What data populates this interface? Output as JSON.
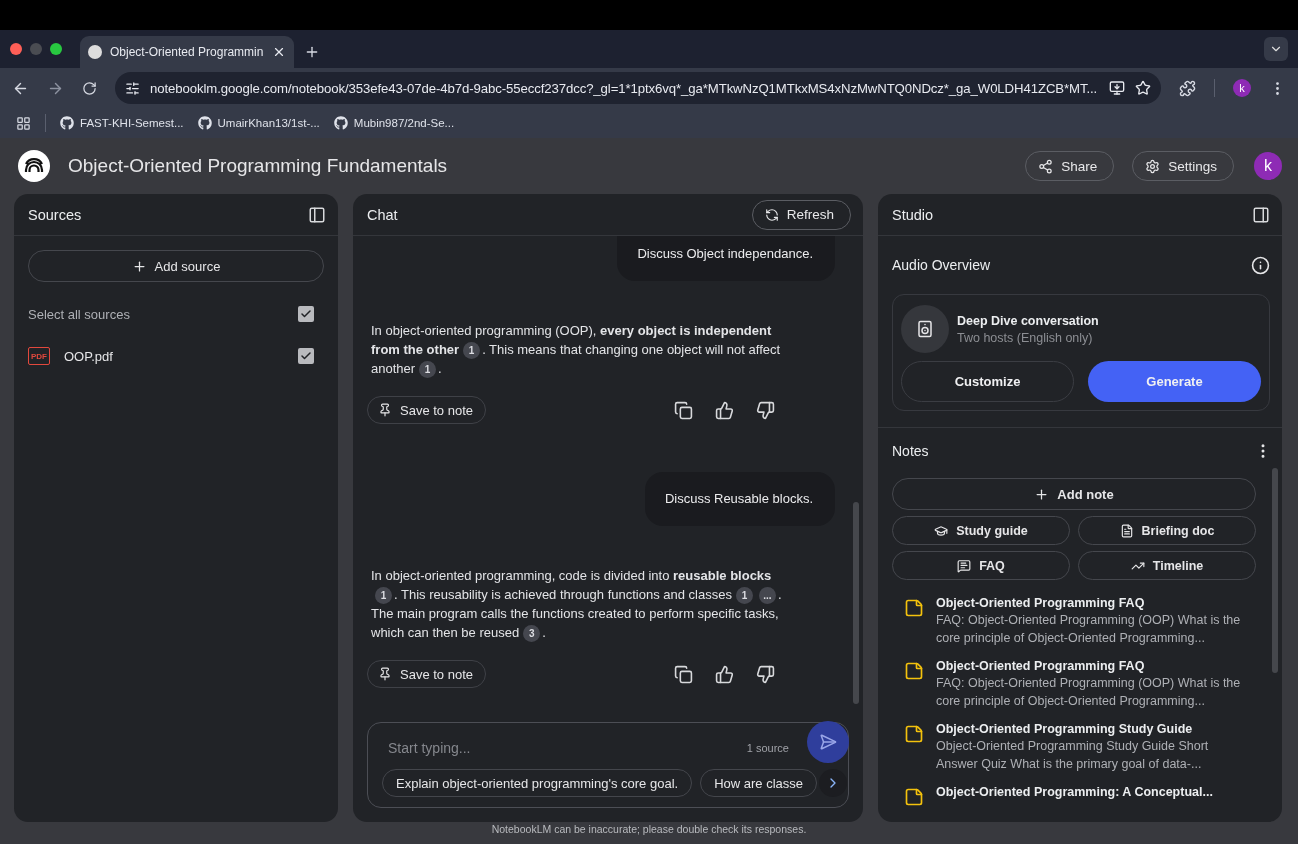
{
  "browser": {
    "tab": {
      "title": "Object-Oriented Programmin",
      "selected": true
    },
    "url": "notebooklm.google.com/notebook/353efe43-07de-4b7d-9abc-55eccf237dcc?_gl=1*1ptx6vq*_ga*MTkwNzQ1MTkxMS4xNzMwNTQ0NDcz*_ga_W0LDH41ZCB*MT...",
    "profile": "k",
    "bookmarks": [
      "FAST-KHI-Semest...",
      "UmairKhan13/1st-...",
      "Mubin987/2nd-Se..."
    ]
  },
  "header": {
    "title": "Object-Oriented Programming Fundamentals",
    "share": "Share",
    "settings": "Settings",
    "avatar": "k"
  },
  "sources": {
    "title": "Sources",
    "add_source": "Add source",
    "select_all": {
      "label": "Select all sources",
      "checked": true
    },
    "items": [
      {
        "badge": "PDF",
        "name": "OOP.pdf",
        "checked": true
      }
    ]
  },
  "chat": {
    "title": "Chat",
    "refresh": "Refresh",
    "messages": [
      {
        "kind": "user",
        "text": "Discuss Object independance."
      },
      {
        "kind": "answer",
        "save": "Save to note",
        "parts": [
          {
            "kind": "text",
            "text": "In object-oriented programming (OOP), **every object is independent from the other**"
          },
          {
            "kind": "cite",
            "text": "1"
          },
          {
            "kind": "text",
            "text": ". This means that changing one object will not affect another"
          },
          {
            "kind": "cite",
            "text": "1"
          },
          {
            "kind": "text",
            "text": "."
          }
        ]
      },
      {
        "kind": "user",
        "text": "Discuss Reusable blocks."
      },
      {
        "kind": "answer",
        "save": "Save to note",
        "parts": [
          {
            "kind": "text",
            "text": "In object-oriented programming, code is divided into **reusable blocks**"
          },
          {
            "kind": "cite",
            "text": "1"
          },
          {
            "kind": "text",
            "text": ". This reusability is achieved through functions and classes"
          },
          {
            "kind": "cite",
            "text": "1"
          },
          {
            "kind": "cite",
            "text": "..."
          },
          {
            "kind": "text",
            "text": ". The main program calls the functions created to perform specific tasks, which can then be reused"
          },
          {
            "kind": "cite",
            "text": "3"
          },
          {
            "kind": "text",
            "text": "."
          }
        ]
      }
    ],
    "input": {
      "placeholder": "Start typing...",
      "source_count": "1 source"
    },
    "suggestions": [
      "Explain object-oriented programming's core goal.",
      "How are classe"
    ]
  },
  "studio": {
    "title": "Studio",
    "audio": {
      "title": "Audio Overview",
      "card_title": "Deep Dive conversation",
      "card_subtitle": "Two hosts (English only)",
      "customize": "Customize",
      "generate": "Generate"
    },
    "notes": {
      "title": "Notes",
      "add_note": "Add note",
      "actions": [
        {
          "kind": "study",
          "label": "Study guide"
        },
        {
          "kind": "briefing",
          "label": "Briefing doc"
        },
        {
          "kind": "faq",
          "label": "FAQ"
        },
        {
          "kind": "timeline",
          "label": "Timeline"
        }
      ],
      "items": [
        {
          "title": "Object-Oriented Programming FAQ",
          "preview": "FAQ: Object-Oriented Programming (OOP) What is the core principle of Object-Oriented Programming..."
        },
        {
          "title": "Object-Oriented Programming FAQ",
          "preview": "FAQ: Object-Oriented Programming (OOP) What is the core principle of Object-Oriented Programming..."
        },
        {
          "title": "Object-Oriented Programming Study Guide",
          "preview": "Object-Oriented Programming Study Guide Short Answer Quiz What is the primary goal of data-..."
        },
        {
          "title": "Object-Oriented Programming: A Conceptual..."
        }
      ]
    }
  },
  "disclaimer": "NotebookLM can be inaccurate; please double check its responses."
}
